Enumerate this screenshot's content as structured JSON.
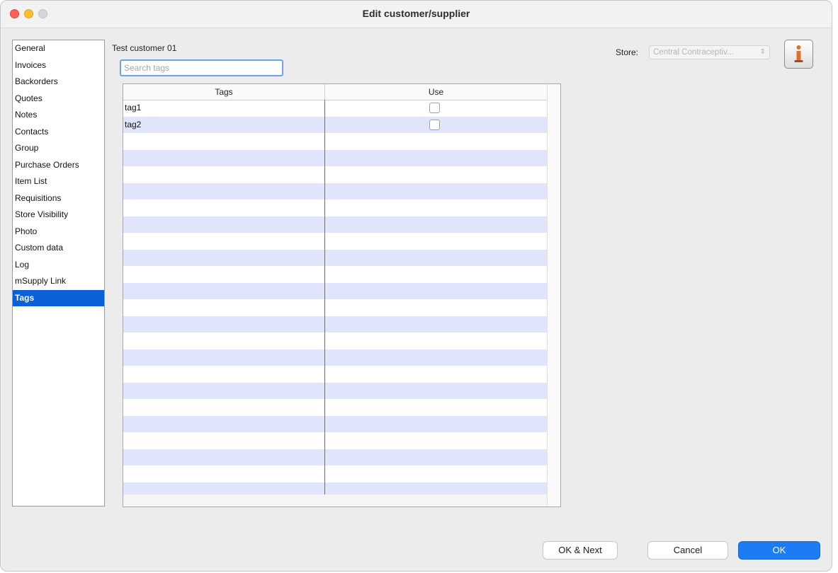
{
  "window": {
    "title": "Edit customer/supplier"
  },
  "sidebar": {
    "items": [
      {
        "label": "General"
      },
      {
        "label": "Invoices"
      },
      {
        "label": "Backorders"
      },
      {
        "label": "Quotes"
      },
      {
        "label": "Notes"
      },
      {
        "label": "Contacts"
      },
      {
        "label": "Group"
      },
      {
        "label": "Purchase Orders"
      },
      {
        "label": "Item List"
      },
      {
        "label": "Requisitions"
      },
      {
        "label": "Store Visibility"
      },
      {
        "label": "Photo"
      },
      {
        "label": "Custom data"
      },
      {
        "label": "Log"
      },
      {
        "label": "mSupply Link"
      },
      {
        "label": "Tags"
      }
    ],
    "selected": "Tags"
  },
  "header": {
    "customer_name": "Test customer 01"
  },
  "search": {
    "placeholder": "Search tags",
    "value": ""
  },
  "store": {
    "label": "Store:",
    "value": "Central Contraceptiv..."
  },
  "info": {
    "icon": "info-icon"
  },
  "table": {
    "columns": [
      "Tags",
      "Use"
    ],
    "rows": [
      {
        "tag": "tag1",
        "use": false
      },
      {
        "tag": "tag2",
        "use": false
      }
    ]
  },
  "footer": {
    "ok_next_label": "OK & Next",
    "cancel_label": "Cancel",
    "ok_label": "OK"
  },
  "colors": {
    "selection": "#0a60d8",
    "row_stripe": "#e1e5fb",
    "primary_button": "#1b7cf4",
    "close": "#ff5f57",
    "minimize": "#febc2e"
  }
}
